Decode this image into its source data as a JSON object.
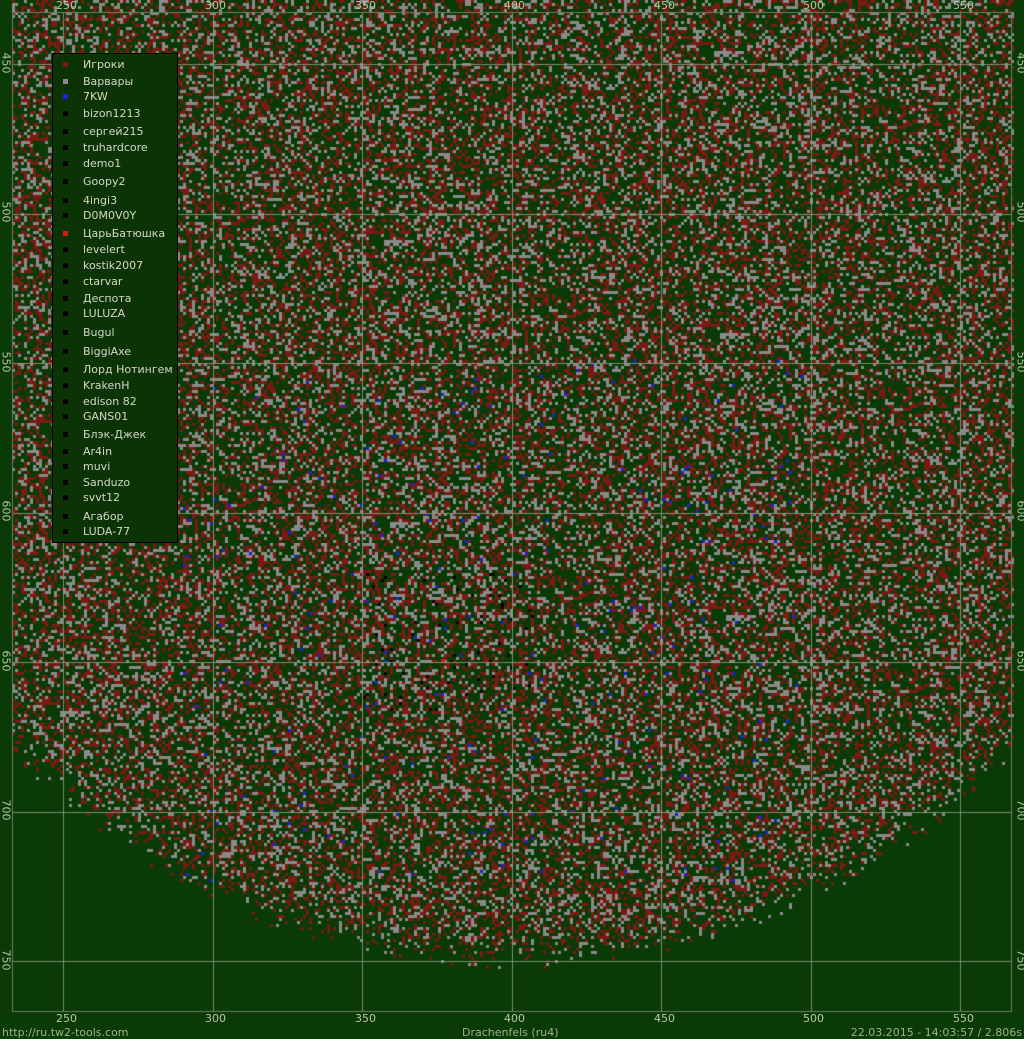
{
  "world": "Drachenfels (ru4)",
  "source_url": "http://ru.tw2-tools.com",
  "timestamp": "22.03.2015 - 14:03:57 / 2.806s",
  "x_ticks": [
    "250",
    "300",
    "350",
    "400",
    "450",
    "500",
    "550"
  ],
  "y_ticks": [
    "450",
    "500",
    "550",
    "600",
    "650",
    "700",
    "750"
  ],
  "colors": {
    "background": "#0a3a06",
    "players": "#7a1a14",
    "barbarians": "#8a8a8a",
    "tribe_7kw": "#1b24d8",
    "black": "#050505",
    "tsar": "#d81a10",
    "grid": "#8c9c84"
  },
  "legend": [
    {
      "label": "Игроки",
      "color": "#7a1a14"
    },
    {
      "label": "Варвары",
      "color": "#8a8a8a"
    },
    {
      "label": "7KW",
      "color": "#1b24d8"
    },
    {
      "label": "bizon1213",
      "color": "#050505"
    },
    {
      "label": "сергей215",
      "color": "#050505"
    },
    {
      "label": "truhardcore",
      "color": "#050505"
    },
    {
      "label": "demo1",
      "color": "#050505"
    },
    {
      "label": "Goopy2",
      "color": "#050505"
    },
    {
      "label": "4ingi3",
      "color": "#050505"
    },
    {
      "label": "D0M0V0Y",
      "color": "#050505"
    },
    {
      "label": "ЦарьБатюшка",
      "color": "#d81a10"
    },
    {
      "label": "levelert",
      "color": "#050505"
    },
    {
      "label": "kostik2007",
      "color": "#050505"
    },
    {
      "label": "ctarvar",
      "color": "#050505"
    },
    {
      "label": "Деспота",
      "color": "#050505"
    },
    {
      "label": "LULUZA",
      "color": "#050505"
    },
    {
      "label": "Bugul",
      "color": "#050505"
    },
    {
      "label": "BiggiAxe",
      "color": "#050505"
    },
    {
      "label": "Лорд Нотингем",
      "color": "#050505"
    },
    {
      "label": "KrakenH",
      "color": "#050505"
    },
    {
      "label": "edison 82",
      "color": "#050505"
    },
    {
      "label": "GANS01",
      "color": "#050505"
    },
    {
      "label": "Блэк-Джек",
      "color": "#050505"
    },
    {
      "label": "Ar4in",
      "color": "#050505"
    },
    {
      "label": "muvi",
      "color": "#050505"
    },
    {
      "label": "Sanduzo",
      "color": "#050505"
    },
    {
      "label": "svvt12",
      "color": "#050505"
    },
    {
      "label": "Агабор",
      "color": "#050505"
    },
    {
      "label": "LUDA-77",
      "color": "#050505"
    }
  ]
}
